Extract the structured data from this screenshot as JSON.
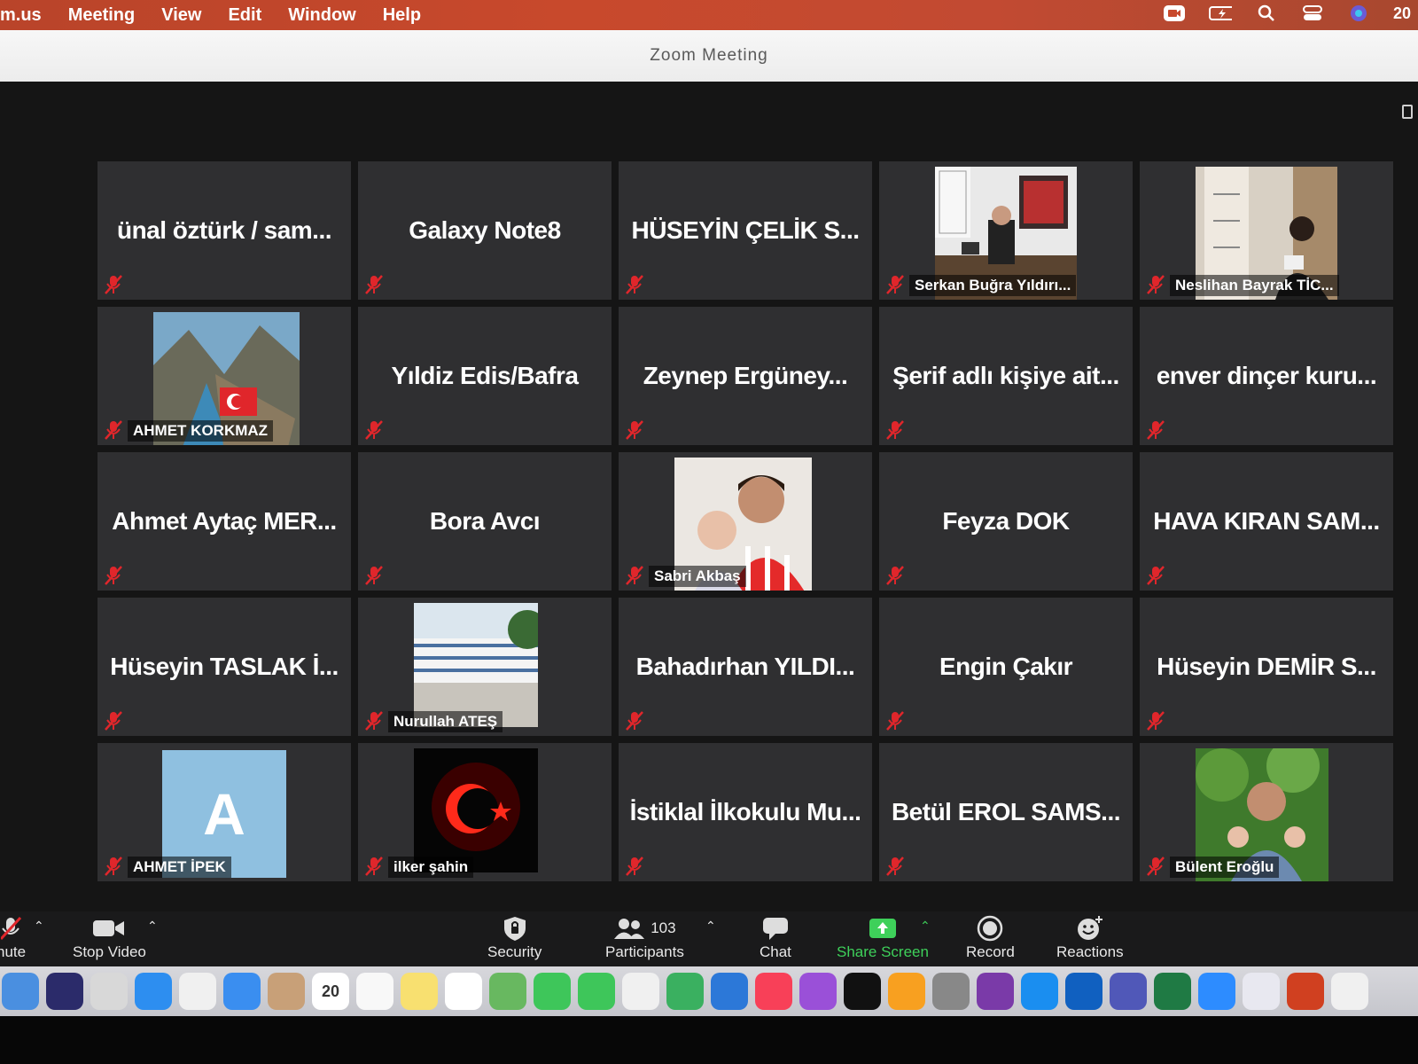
{
  "menubar": {
    "app": "m.us",
    "items": [
      "Meeting",
      "View",
      "Edit",
      "Window",
      "Help"
    ],
    "clock": "20"
  },
  "window": {
    "title": "Zoom Meeting"
  },
  "tiles": [
    {
      "name": "ünal öztürk  /  sam...",
      "video": false
    },
    {
      "name": "Galaxy Note8",
      "video": false
    },
    {
      "name": "HÜSEYİN ÇELİK S...",
      "video": false
    },
    {
      "name": "Serkan Buğra Yıldırı...",
      "video": true,
      "photo": "office"
    },
    {
      "name": "Neslihan Bayrak TİC...",
      "video": true,
      "photo": "reading"
    },
    {
      "name": "AHMET KORKMAZ",
      "video": true,
      "photo": "flag-mountain"
    },
    {
      "name": "Yıldiz Edis/Bafra",
      "video": false
    },
    {
      "name": "Zeynep Ergüney...",
      "video": false
    },
    {
      "name": "Şerif adlı kişiye ait...",
      "video": false
    },
    {
      "name": "enver dinçer kuru...",
      "video": false
    },
    {
      "name": "Ahmet Aytaç MER...",
      "video": false
    },
    {
      "name": "Bora Avcı",
      "video": false
    },
    {
      "name": "Sabri Akbaş",
      "video": true,
      "photo": "selfie"
    },
    {
      "name": "Feyza DOK",
      "video": false
    },
    {
      "name": "HAVA KIRAN SAM...",
      "video": false
    },
    {
      "name": "Hüseyin TASLAK İ...",
      "video": false
    },
    {
      "name": "Nurullah ATEŞ",
      "video": true,
      "photo": "school"
    },
    {
      "name": "Bahadırhan YILDI...",
      "video": false
    },
    {
      "name": "Engin Çakır",
      "video": false
    },
    {
      "name": "Hüseyin DEMİR S...",
      "video": false
    },
    {
      "name": "AHMET İPEK",
      "video": true,
      "photo": "avatar",
      "initial": "A"
    },
    {
      "name": "ilker şahin",
      "video": true,
      "photo": "red-flag"
    },
    {
      "name": "İstiklal İlkokulu Mu...",
      "video": false
    },
    {
      "name": "Betül EROL SAMS...",
      "video": false
    },
    {
      "name": "Bülent Eroğlu",
      "video": true,
      "photo": "family"
    }
  ],
  "toolbar": {
    "mute": "nute",
    "stop_video": "Stop Video",
    "security": "Security",
    "participants": "Participants",
    "participant_count": "103",
    "chat": "Chat",
    "share_screen": "Share Screen",
    "record": "Record",
    "reactions": "Reactions"
  },
  "dock": {
    "calendar_day": "20",
    "apps": [
      "finder",
      "siri",
      "launchpad",
      "safari",
      "chrome",
      "mail",
      "contacts",
      "calendar",
      "photos",
      "notes",
      "reminders",
      "maps",
      "messages",
      "facetime",
      "freeform",
      "numbers",
      "keynote",
      "music",
      "podcasts",
      "tv",
      "books",
      "system-preferences",
      "onenote",
      "app-store",
      "malwarebytes",
      "teams",
      "excel",
      "zoom",
      "preview",
      "powerpoint",
      "screenshot"
    ]
  },
  "colors": {
    "accent_green": "#3ed05a",
    "mute_red": "#e0262b",
    "tile_bg": "#2f2f31"
  }
}
